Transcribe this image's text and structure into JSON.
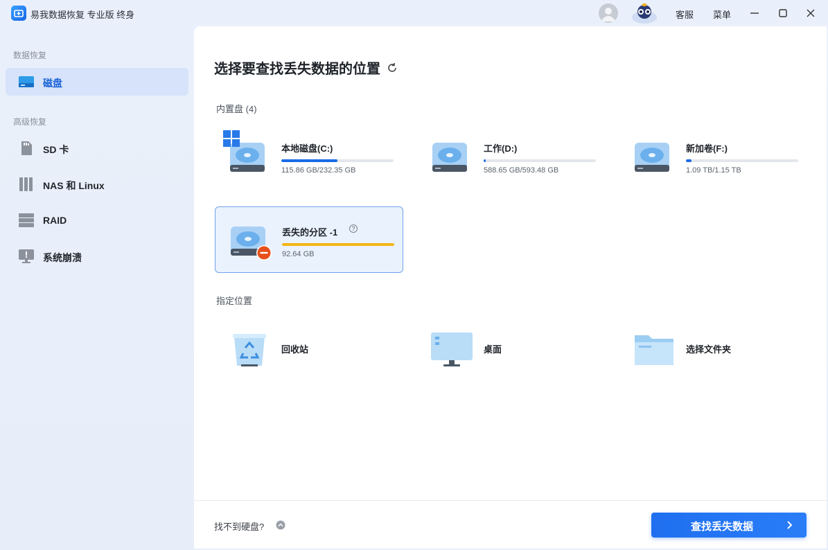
{
  "app": {
    "title": "易我数据恢复 专业版 终身"
  },
  "titlebar": {
    "support": "客服",
    "menu": "菜单"
  },
  "sidebar": {
    "section_data": "数据恢复",
    "section_advanced": "高级恢复",
    "items": [
      {
        "label": "磁盘",
        "icon": "disk-icon",
        "active": true
      },
      {
        "label": "SD 卡",
        "icon": "sd-card-icon"
      },
      {
        "label": "NAS 和 Linux",
        "icon": "nas-icon"
      },
      {
        "label": "RAID",
        "icon": "raid-icon"
      },
      {
        "label": "系统崩溃",
        "icon": "system-crash-icon"
      }
    ]
  },
  "main": {
    "title": "选择要查找丢失数据的位置",
    "internal_label": "内置盘",
    "internal_count": "(4)",
    "drives": [
      {
        "name": "本地磁盘(C:)",
        "size": "115.86 GB/232.35 GB",
        "usage": 0.499,
        "color": "#1a6ae6"
      },
      {
        "name": "工作(D:)",
        "size": "588.65 GB/593.48 GB",
        "usage": 0.02,
        "color": "#1a6ae6"
      },
      {
        "name": "新加卷(F:)",
        "size": "1.09 TB/1.15 TB",
        "usage": 0.05,
        "color": "#1a6ae6"
      },
      {
        "name": "丢失的分区 -1",
        "size": "92.64 GB",
        "usage": 1.0,
        "color": "#f5b614",
        "help": "?"
      }
    ],
    "specified_label": "指定位置",
    "locations": [
      {
        "label": "回收站",
        "icon": "recycle-bin-icon"
      },
      {
        "label": "桌面",
        "icon": "desktop-icon"
      },
      {
        "label": "选择文件夹",
        "icon": "folder-icon"
      }
    ]
  },
  "footer": {
    "cant_find": "找不到硬盘?",
    "scan_button": "查找丢失数据"
  }
}
